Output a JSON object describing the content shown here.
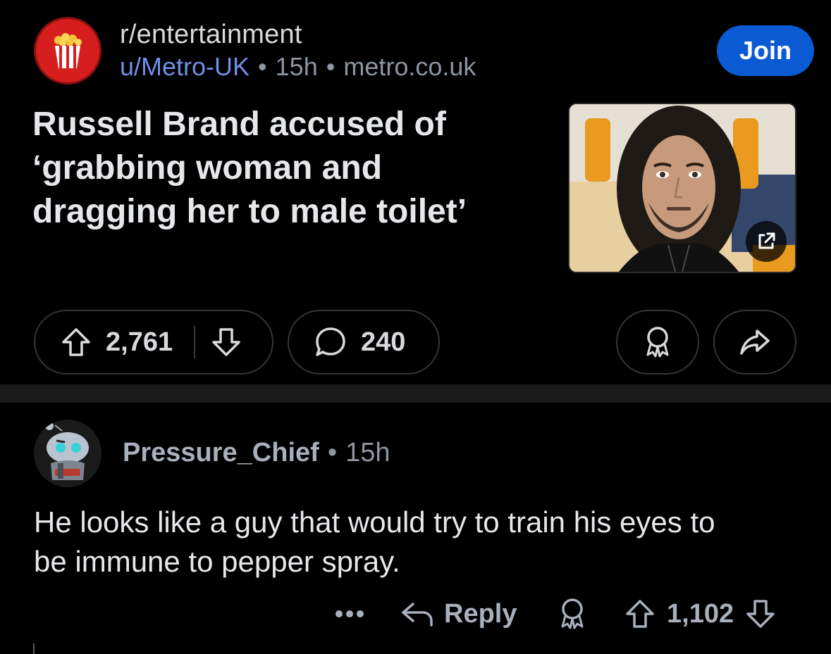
{
  "post": {
    "subreddit": "r/entertainment",
    "author": "u/Metro-UK",
    "age": "15h",
    "domain": "metro.co.uk",
    "separator": "•",
    "join_label": "Join",
    "title_lines": [
      "Russell Brand accused of",
      "‘grabbing woman and",
      "dragging her to male toilet’"
    ],
    "thumbnail_icon": "external-link-icon",
    "upvotes": "2,761",
    "comments": "240"
  },
  "comment": {
    "username": "Pressure_Chief",
    "separator": "•",
    "age": "15h",
    "body_lines": [
      "He looks like a guy that would try to train his eyes to",
      "be immune to pepper spray."
    ],
    "more_label": "•••",
    "reply_label": "Reply",
    "votes": "1,102"
  },
  "colors": {
    "background": "#000000",
    "accent_join": "#0a5bd3",
    "author_link": "#6f8fe8",
    "muted": "#8c95a0",
    "pill_border": "#343536"
  }
}
